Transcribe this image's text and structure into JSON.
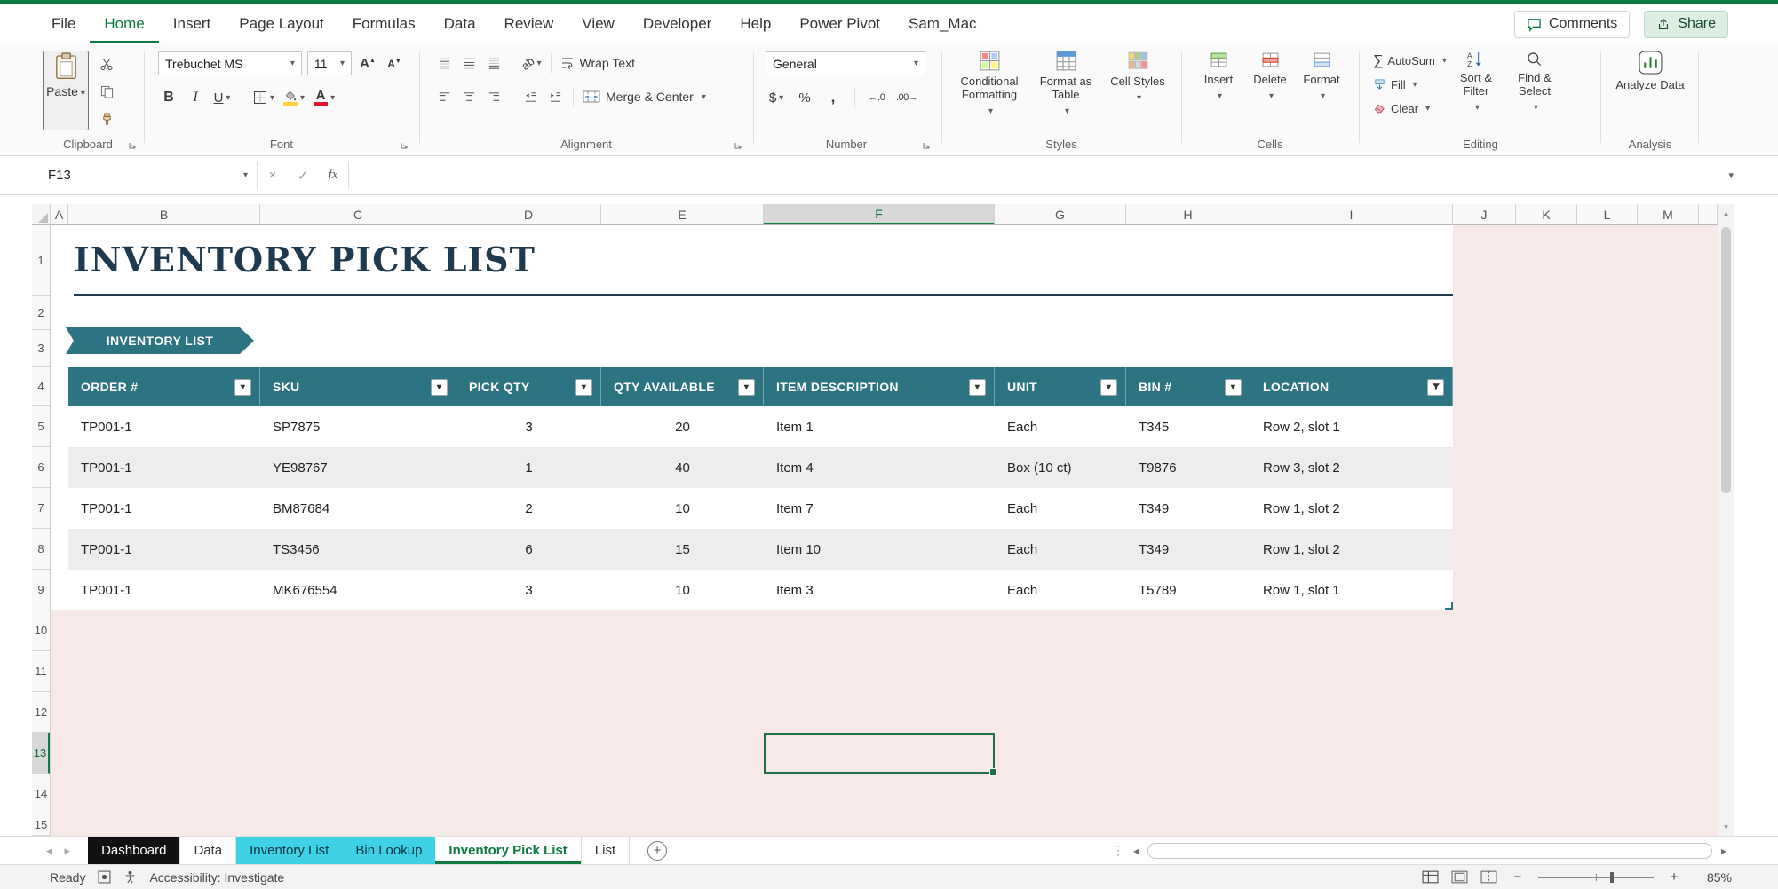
{
  "colors": {
    "accent_green": "#0f7b41",
    "teal": "#2d7482",
    "title_navy": "#1f3a4f",
    "sheet_pink": "#f8e9e9",
    "band_gray": "#ededed",
    "tab_cyan": "#3fd2e6",
    "selection_green": "#1e7145"
  },
  "chrome": {
    "menu": [
      "File",
      "Home",
      "Insert",
      "Page Layout",
      "Formulas",
      "Data",
      "Review",
      "View",
      "Developer",
      "Help",
      "Power Pivot",
      "Sam_Mac"
    ],
    "active_menu": "Home",
    "comments_label": "Comments",
    "share_label": "Share"
  },
  "ribbon": {
    "clipboard": {
      "label": "Clipboard",
      "paste": "Paste"
    },
    "font": {
      "label": "Font",
      "font_name": "Trebuchet MS",
      "font_size": "11",
      "bold": "B",
      "italic": "I",
      "underline": "U"
    },
    "alignment": {
      "label": "Alignment",
      "wrap_text": "Wrap Text",
      "merge_center": "Merge & Center"
    },
    "number": {
      "label": "Number",
      "format": "General",
      "currency": "$",
      "percent": "%",
      "comma": ","
    },
    "styles": {
      "label": "Styles",
      "conditional": "Conditional Formatting",
      "format_table": "Format as Table",
      "cell_styles": "Cell Styles"
    },
    "cells": {
      "label": "Cells",
      "insert": "Insert",
      "delete": "Delete",
      "format": "Format"
    },
    "editing": {
      "label": "Editing",
      "autosum": "AutoSum",
      "fill": "Fill",
      "clear": "Clear",
      "sort_filter": "Sort & Filter",
      "find_select": "Find & Select"
    },
    "analysis": {
      "label": "Analysis",
      "analyze": "Analyze Data"
    }
  },
  "formula_bar": {
    "name_box": "F13",
    "formula": "",
    "fx": "fx"
  },
  "grid": {
    "columns": [
      "A",
      "B",
      "C",
      "D",
      "E",
      "F",
      "G",
      "H",
      "I",
      "J",
      "K",
      "L",
      "M"
    ],
    "rows": [
      "1",
      "2",
      "3",
      "4",
      "5",
      "6",
      "7",
      "8",
      "9",
      "10",
      "11",
      "12",
      "13",
      "14",
      "15"
    ],
    "selected_column": "F",
    "selected_row": "13",
    "selected_cell": "F13"
  },
  "sheet": {
    "title": "INVENTORY PICK LIST",
    "banner": "INVENTORY LIST",
    "table": {
      "headers": [
        "ORDER #",
        "SKU",
        "PICK QTY",
        "QTY AVAILABLE",
        "ITEM DESCRIPTION",
        "UNIT",
        "BIN #",
        "LOCATION"
      ],
      "rows": [
        [
          "TP001-1",
          "SP7875",
          "3",
          "20",
          "Item 1",
          "Each",
          "T345",
          "Row 2, slot 1"
        ],
        [
          "TP001-1",
          "YE98767",
          "1",
          "40",
          "Item 4",
          "Box (10 ct)",
          "T9876",
          "Row 3, slot 2"
        ],
        [
          "TP001-1",
          "BM87684",
          "2",
          "10",
          "Item 7",
          "Each",
          "T349",
          "Row 1, slot 2"
        ],
        [
          "TP001-1",
          "TS3456",
          "6",
          "15",
          "Item 10",
          "Each",
          "T349",
          "Row 1, slot 2"
        ],
        [
          "TP001-1",
          "MK676554",
          "3",
          "10",
          "Item 3",
          "Each",
          "T5789",
          "Row 1, slot 1"
        ]
      ]
    }
  },
  "sheet_tabs": [
    {
      "label": "Dashboard",
      "style": "black"
    },
    {
      "label": "Data",
      "style": "default"
    },
    {
      "label": "Inventory List",
      "style": "cyan"
    },
    {
      "label": "Bin Lookup",
      "style": "cyan"
    },
    {
      "label": "Inventory Pick List",
      "style": "active"
    },
    {
      "label": "List",
      "style": "default"
    }
  ],
  "status": {
    "ready": "Ready",
    "accessibility": "Accessibility: Investigate",
    "zoom": "85%"
  },
  "icons": {
    "dropdown": "▾",
    "autosum": "∑",
    "increase_decimal": "←.0",
    "decrease_decimal": ".00→",
    "cancel": "×",
    "enter": "✓",
    "add_sheet": "+",
    "nav_left": "◂",
    "nav_right": "▸",
    "scroll_up": "▴",
    "scroll_down": "▾",
    "zoom_in": "+",
    "zoom_out": "−",
    "splitter": "⋮"
  }
}
